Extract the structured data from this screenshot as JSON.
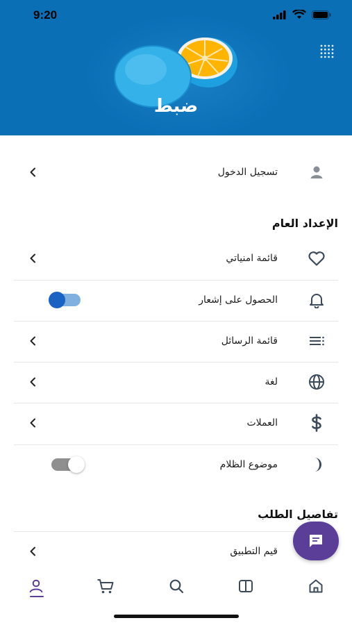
{
  "status_bar": {
    "time": "9:20"
  },
  "header": {
    "title": "ضبط"
  },
  "account": {
    "login_label": "تسجيل الدخول"
  },
  "general": {
    "title": "الإعداد العام",
    "items": [
      {
        "label": "قائمة امنياتي",
        "icon": "heart-icon"
      },
      {
        "label": "الحصول على إشعار",
        "icon": "bell-icon",
        "toggle": "on"
      },
      {
        "label": "قائمة الرسائل",
        "icon": "list-icon"
      },
      {
        "label": "لغة",
        "icon": "globe-icon"
      },
      {
        "label": "العملات",
        "icon": "dollar-icon"
      },
      {
        "label": "موضوع الظلام",
        "icon": "moon-icon",
        "toggle": "off"
      }
    ]
  },
  "order": {
    "title": "تفاصيل الطلب",
    "items": [
      {
        "label": "قيم التطبيق",
        "icon": "star-icon"
      }
    ]
  },
  "bottom_nav": {
    "items": [
      "profile-icon",
      "cart-icon",
      "search-icon",
      "book-icon",
      "home-icon"
    ],
    "active": "profile-icon"
  },
  "colors": {
    "header_bg": "#0b6fb6",
    "accent": "#5a3e98",
    "toggle_on": "#1a63c3",
    "icon": "#3c4a5a"
  }
}
